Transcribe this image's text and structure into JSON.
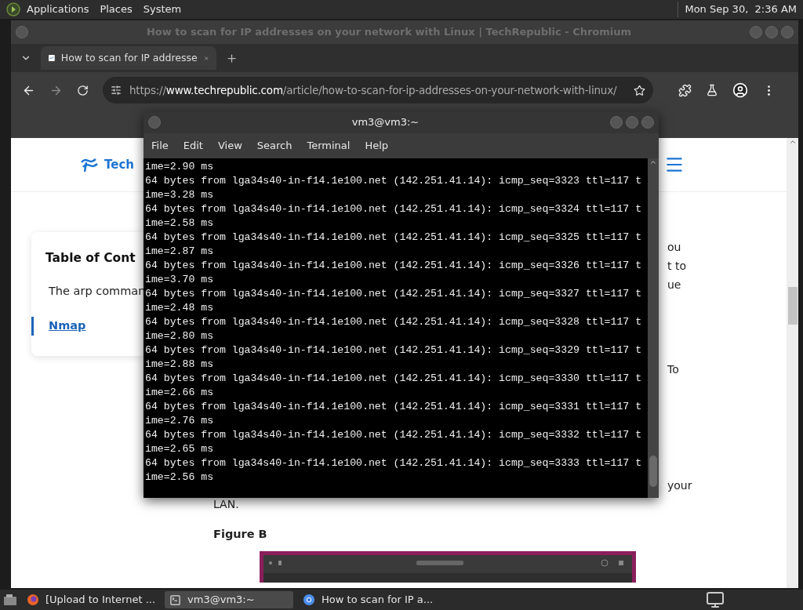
{
  "top_panel": {
    "menus": [
      "Applications",
      "Places",
      "System"
    ],
    "clock": "Mon Sep 30,  2:36 AM"
  },
  "browser": {
    "title": "How to scan for IP addresses on your network with Linux | TechRepublic - Chromium",
    "tabs": [
      {
        "label": "How to scan for IP addresse",
        "selected": true
      }
    ],
    "url": {
      "scheme": "https://",
      "host": "www.techrepublic.com",
      "path": "/article/how-to-scan-for-ip-addresses-on-your-network-with-linux/"
    },
    "page": {
      "logo_text": "Tech",
      "toc": {
        "title": "Table of Cont",
        "items": [
          {
            "label": "The arp comman",
            "selected": false
          },
          {
            "label": "Nmap",
            "selected": true
          }
        ]
      },
      "right_fragments": [
        "ou",
        "t to",
        "ue",
        "To",
        "your"
      ],
      "paragraph_end": "LAN.",
      "figure_label": "Figure B",
      "figure": {
        "kind": "picture"
      }
    }
  },
  "terminal": {
    "title": "vm3@vm3:~",
    "menu": [
      "File",
      "Edit",
      "View",
      "Search",
      "Terminal",
      "Help"
    ],
    "lines": [
      "ime=2.90 ms",
      "64 bytes from lga34s40-in-f14.1e100.net (142.251.41.14): icmp_seq=3323 ttl=117 t",
      "ime=3.28 ms",
      "64 bytes from lga34s40-in-f14.1e100.net (142.251.41.14): icmp_seq=3324 ttl=117 t",
      "ime=2.58 ms",
      "64 bytes from lga34s40-in-f14.1e100.net (142.251.41.14): icmp_seq=3325 ttl=117 t",
      "ime=2.87 ms",
      "64 bytes from lga34s40-in-f14.1e100.net (142.251.41.14): icmp_seq=3326 ttl=117 t",
      "ime=3.70 ms",
      "64 bytes from lga34s40-in-f14.1e100.net (142.251.41.14): icmp_seq=3327 ttl=117 t",
      "ime=2.48 ms",
      "64 bytes from lga34s40-in-f14.1e100.net (142.251.41.14): icmp_seq=3328 ttl=117 t",
      "ime=2.80 ms",
      "64 bytes from lga34s40-in-f14.1e100.net (142.251.41.14): icmp_seq=3329 ttl=117 t",
      "ime=2.88 ms",
      "64 bytes from lga34s40-in-f14.1e100.net (142.251.41.14): icmp_seq=3330 ttl=117 t",
      "ime=2.66 ms",
      "64 bytes from lga34s40-in-f14.1e100.net (142.251.41.14): icmp_seq=3331 ttl=117 t",
      "ime=2.76 ms",
      "64 bytes from lga34s40-in-f14.1e100.net (142.251.41.14): icmp_seq=3332 ttl=117 t",
      "ime=2.65 ms",
      "64 bytes from lga34s40-in-f14.1e100.net (142.251.41.14): icmp_seq=3333 ttl=117 t",
      "ime=2.56 ms"
    ]
  },
  "taskbar": {
    "items": [
      {
        "kind": "firefox",
        "label": "[Upload to Internet ...",
        "selected": false
      },
      {
        "kind": "terminal",
        "label": "vm3@vm3:~",
        "selected": true
      },
      {
        "kind": "chromium",
        "label": "How to scan for IP a...",
        "selected": false
      }
    ]
  }
}
